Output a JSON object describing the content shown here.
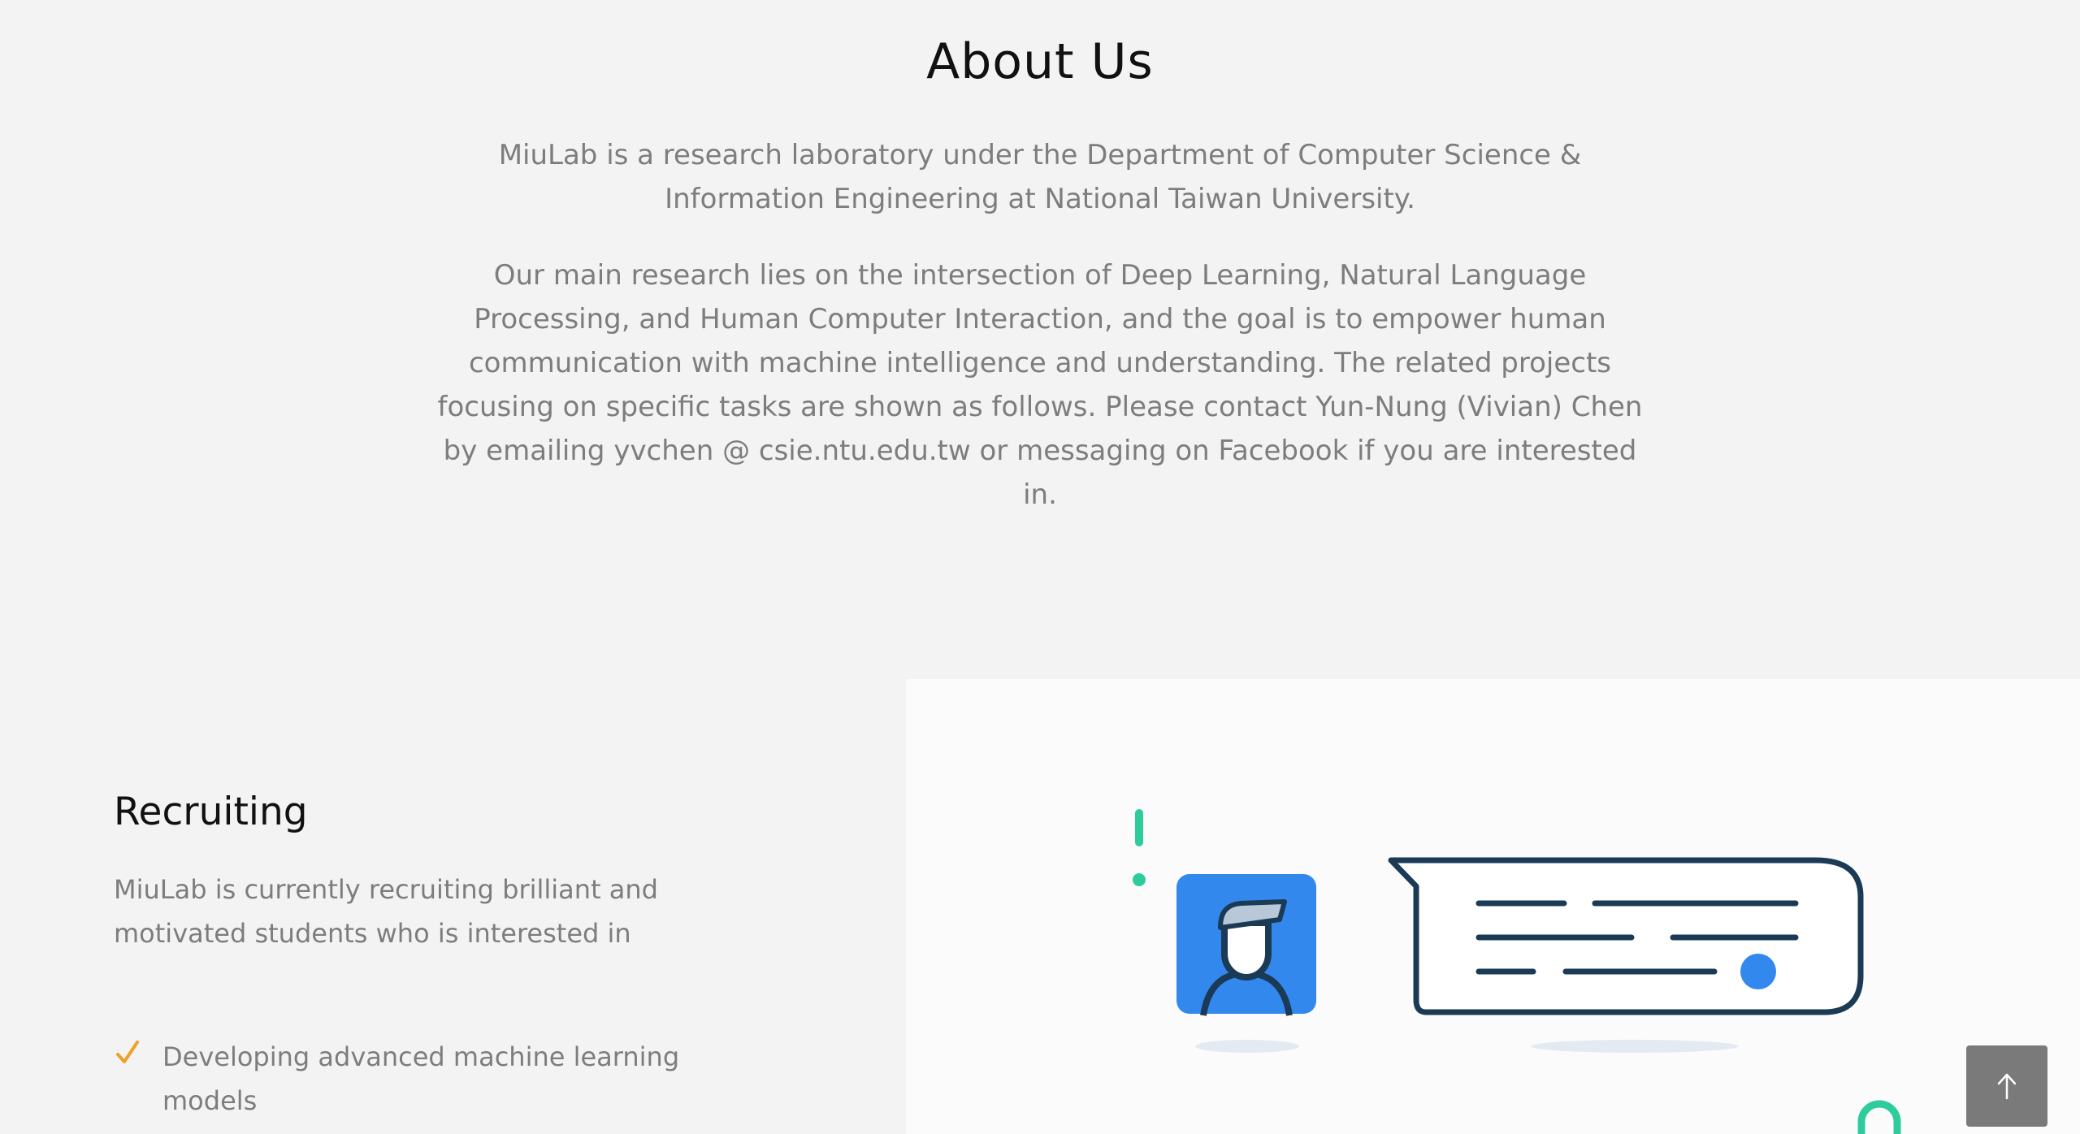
{
  "about": {
    "title": "About Us",
    "paragraph1": "MiuLab is a research laboratory under the Department of Computer Science & Information Engineering at National Taiwan University.",
    "paragraph2": "Our main research lies on the intersection of Deep Learning, Natural Language Processing, and Human Computer Interaction, and the goal is to empower human communication with machine intelligence and understanding. The related projects focusing on specific tasks are shown as follows. Please contact Yun-Nung (Vivian) Chen by emailing yvchen @ csie.ntu.edu.tw or messaging on Facebook if you are interested in."
  },
  "recruiting": {
    "title": "Recruiting",
    "text": "MiuLab is currently recruiting brilliant and motivated students who is interested in",
    "items": [
      {
        "label": "Developing advanced machine learning models"
      }
    ]
  },
  "icons": {
    "check": "check-icon",
    "back_to_top": "arrow-up-icon",
    "illustration": "chat-illustration"
  },
  "colors": {
    "background": "#f3f3f3",
    "accent_orange": "#f0a028",
    "illustration_blue": "#3388ee",
    "illustration_navy": "#1a3a55",
    "illustration_teal": "#2ecc9c",
    "back_to_top_bg": "#7a7a7a"
  }
}
